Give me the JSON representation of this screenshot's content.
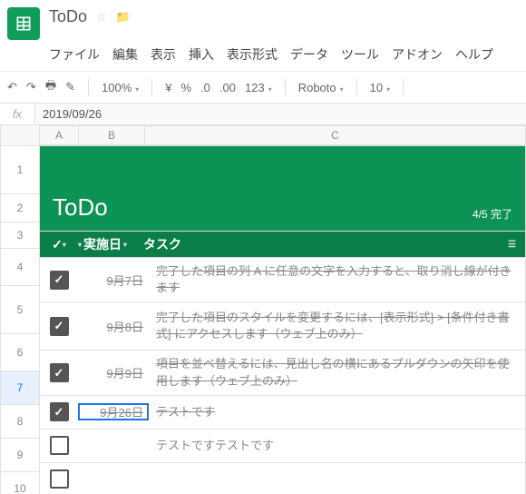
{
  "doc_title": "ToDo",
  "menu": [
    "ファイル",
    "編集",
    "表示",
    "挿入",
    "表示形式",
    "データ",
    "ツール",
    "アドオン",
    "ヘルプ"
  ],
  "toolbar": {
    "zoom": "100%",
    "yen": "¥",
    "pct": "%",
    "d1": ".0",
    "d2": ".00",
    "num": "123",
    "font": "Roboto",
    "size": "10"
  },
  "fx": "2019/09/26",
  "cols": [
    "A",
    "B",
    "C"
  ],
  "rownums": [
    "1",
    "2",
    "3",
    "4",
    "5",
    "6",
    "7",
    "8",
    "9",
    "10"
  ],
  "title": "ToDo",
  "progress": "4/5 完了",
  "headers": {
    "date": "実施日",
    "task": "タスク"
  },
  "rows": [
    {
      "done": true,
      "date": "9月7日",
      "task": "完了した項目の列 A に任意の文字を入力すると、取り消し線が付きます"
    },
    {
      "done": true,
      "date": "9月8日",
      "task": "完了した項目のスタイルを変更するには、[表示形式] > [条件付き書式] にアクセスします（ウェブ上のみ）"
    },
    {
      "done": true,
      "date": "9月9日",
      "task": "項目を並べ替えるには、見出し名の横にあるプルダウンの矢印を使用します（ウェブ上のみ）"
    },
    {
      "done": true,
      "date": "9月26日",
      "task": "テストです",
      "selected": true
    },
    {
      "done": false,
      "date": "",
      "task": "テストですテストです"
    },
    {
      "done": false,
      "date": "",
      "task": ""
    },
    {
      "done": false,
      "date": "",
      "task": ""
    }
  ]
}
